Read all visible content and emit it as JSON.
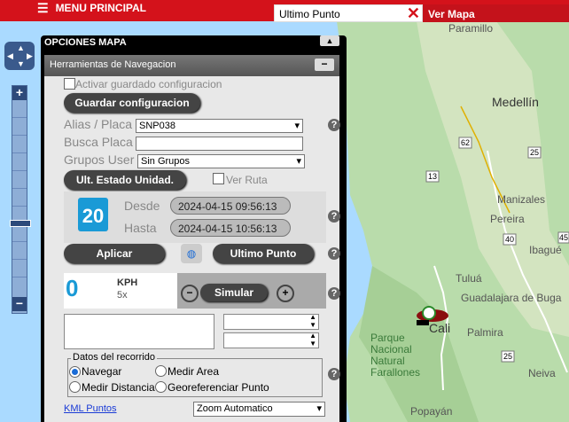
{
  "header": {
    "menu_label": "MENU PRINCIPAL",
    "search_value": "Ultimo Punto",
    "ver_mapa": "Ver Mapa"
  },
  "panel": {
    "title": "OPCIONES MAPA",
    "section_title": "Herramientas de Navegacion",
    "save_config_checkbox": "Activar guardado configuracion",
    "save_button": "Guardar configuracion",
    "alias_label": "Alias / Placa",
    "alias_value": "SNP038",
    "busca_label": "Busca Placa",
    "busca_value": "",
    "grupos_label": "Grupos User",
    "grupos_value": "Sin Grupos",
    "ult_estado_button": "Ult. Estado Unidad.",
    "ver_ruta_label": "Ver Ruta",
    "calendar_day": "20",
    "desde_label": "Desde",
    "desde_value": "2024-04-15 09:56:13",
    "hasta_label": "Hasta",
    "hasta_value": "2024-04-15 10:56:13",
    "aplicar_button": "Aplicar",
    "ultimo_punto_button": "Ultimo Punto",
    "speed_value": "0",
    "speed_unit": "KPH",
    "speed_mult": "5x",
    "simular_button": "Simular",
    "recorrido_legend": "Datos del recorrido",
    "radio_navegar": "Navegar",
    "radio_medir_area": "Medir Area",
    "radio_medir_distancia": "Medir Distancia",
    "radio_georef": "Georeferenciar Punto",
    "kml_link": "KML Puntos",
    "zoom_select": "Zoom Automatico",
    "help": "?"
  },
  "map": {
    "labels": {
      "paramillo": "Paramillo",
      "medellin": "Medellín",
      "manizales": "Manizales",
      "pereira": "Pereira",
      "ibague": "Ibagué",
      "tulua": "Tuluá",
      "guadalajara": "Guadalajara de Buga",
      "cali": "Cali",
      "palmira": "Palmira",
      "parque": "Parque Nacional Natural Farallones",
      "neiva": "Neiva",
      "popayan": "Popayán"
    },
    "route_shields": [
      "62",
      "25",
      "13",
      "40",
      "45",
      "25"
    ]
  },
  "colors": {
    "brand_red": "#d4121b",
    "map_green": "#b9dcab",
    "sea": "#aadaff"
  }
}
